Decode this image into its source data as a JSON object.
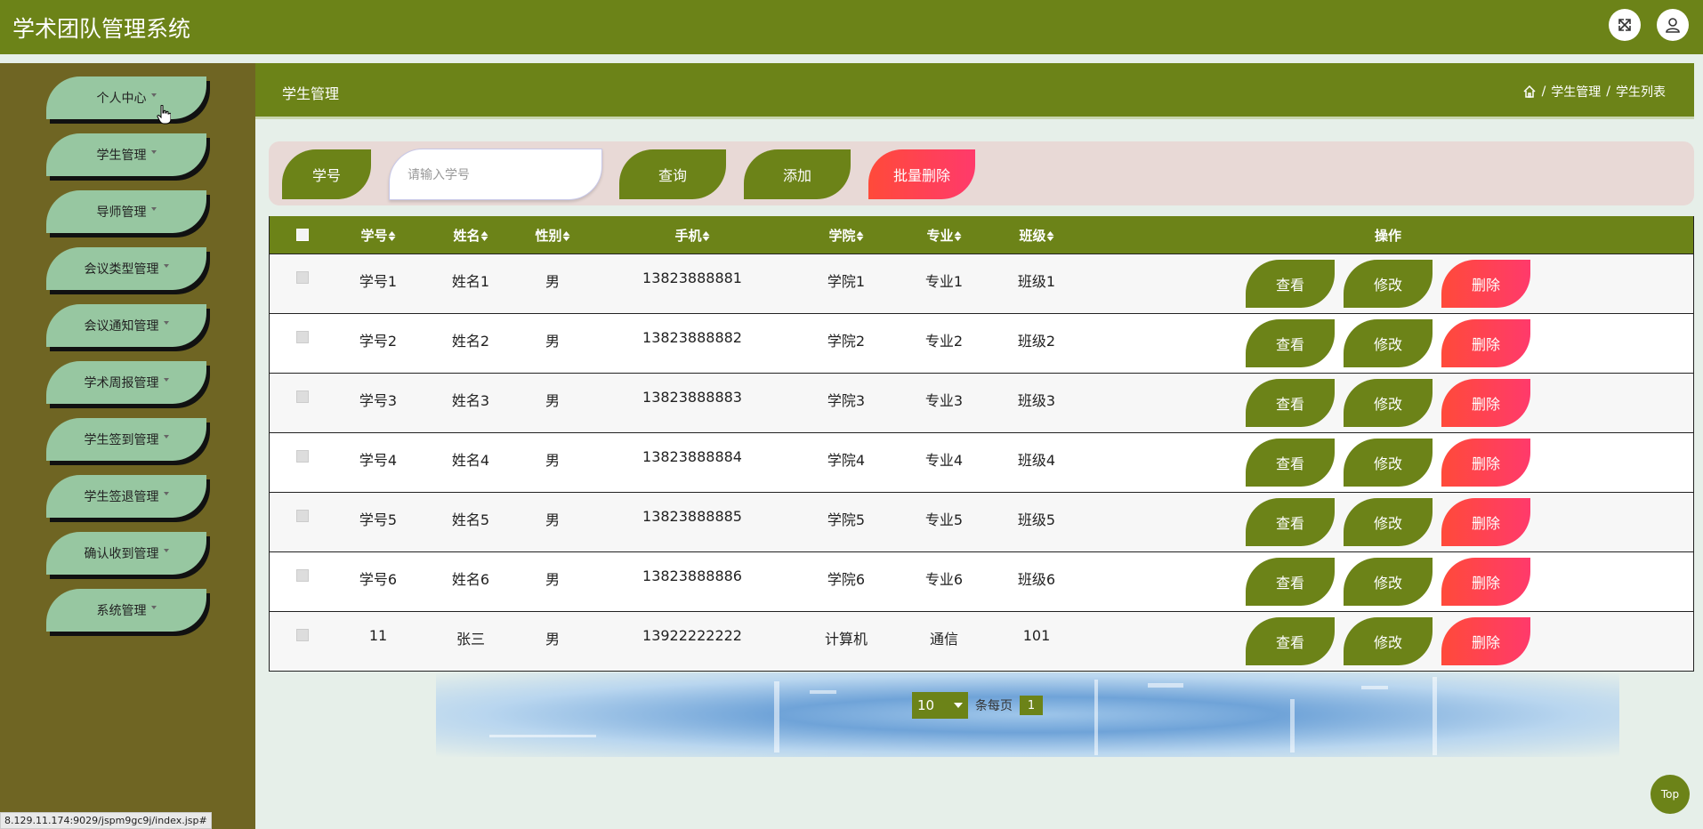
{
  "app": {
    "title": "学术团队管理系统"
  },
  "icons": {
    "fullscreen": "expand-icon",
    "user": "user-icon",
    "home": "home-icon"
  },
  "sidebar": {
    "items": [
      {
        "label": "个人中心"
      },
      {
        "label": "学生管理"
      },
      {
        "label": "导师管理"
      },
      {
        "label": "会议类型管理"
      },
      {
        "label": "会议通知管理"
      },
      {
        "label": "学术周报管理"
      },
      {
        "label": "学生签到管理"
      },
      {
        "label": "学生签退管理"
      },
      {
        "label": "确认收到管理"
      },
      {
        "label": "系统管理"
      }
    ]
  },
  "header": {
    "title": "学生管理",
    "breadcrumb": {
      "sep1": "/",
      "item1": "学生管理",
      "sep2": "/",
      "item2": "学生列表"
    }
  },
  "search": {
    "label": "学号",
    "placeholder": "请输入学号",
    "query_label": "查询",
    "add_label": "添加",
    "batch_delete_label": "批量删除"
  },
  "table": {
    "headers": {
      "xuehao": "学号",
      "xingming": "姓名",
      "xingbie": "性别",
      "shouji": "手机",
      "xueyuan": "学院",
      "zhuanye": "专业",
      "banji": "班级",
      "caozuo": "操作"
    },
    "actions": {
      "view": "查看",
      "edit": "修改",
      "delete": "删除"
    },
    "rows": [
      {
        "xuehao": "学号1",
        "xingming": "姓名1",
        "xingbie": "男",
        "shouji": "13823888881",
        "xueyuan": "学院1",
        "zhuanye": "专业1",
        "banji": "班级1"
      },
      {
        "xuehao": "学号2",
        "xingming": "姓名2",
        "xingbie": "男",
        "shouji": "13823888882",
        "xueyuan": "学院2",
        "zhuanye": "专业2",
        "banji": "班级2"
      },
      {
        "xuehao": "学号3",
        "xingming": "姓名3",
        "xingbie": "男",
        "shouji": "13823888883",
        "xueyuan": "学院3",
        "zhuanye": "专业3",
        "banji": "班级3"
      },
      {
        "xuehao": "学号4",
        "xingming": "姓名4",
        "xingbie": "男",
        "shouji": "13823888884",
        "xueyuan": "学院4",
        "zhuanye": "专业4",
        "banji": "班级4"
      },
      {
        "xuehao": "学号5",
        "xingming": "姓名5",
        "xingbie": "男",
        "shouji": "13823888885",
        "xueyuan": "学院5",
        "zhuanye": "专业5",
        "banji": "班级5"
      },
      {
        "xuehao": "学号6",
        "xingming": "姓名6",
        "xingbie": "男",
        "shouji": "13823888886",
        "xueyuan": "学院6",
        "zhuanye": "专业6",
        "banji": "班级6"
      },
      {
        "xuehao": "11",
        "xingming": "张三",
        "xingbie": "男",
        "shouji": "13922222222",
        "xueyuan": "计算机",
        "zhuanye": "通信",
        "banji": "101"
      }
    ]
  },
  "pagination": {
    "page_size": "10",
    "per_page_label": "条每页",
    "current_page": "1"
  },
  "back_to_top": "Top",
  "status_url": "8.129.11.174:9029/jspm9gc9j/index.jsp#",
  "colors": {
    "primary": "#6c8318",
    "sidebar": "#6f6523",
    "menu_item": "#97c7a1",
    "danger": "#ff4a5a"
  }
}
